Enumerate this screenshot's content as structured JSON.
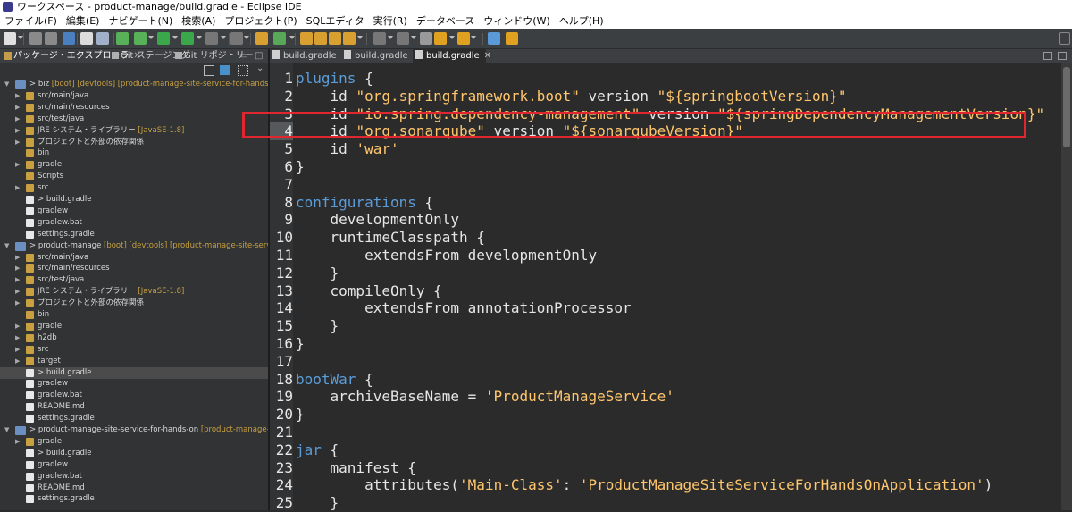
{
  "window": {
    "title": "ワークスペース - product-manage/build.gradle - Eclipse IDE"
  },
  "menu": [
    "ファイル(F)",
    "編集(E)",
    "ナビゲート(N)",
    "検索(A)",
    "プロジェクト(P)",
    "SQLエディタ",
    "実行(R)",
    "データベース",
    "ウィンドウ(W)",
    "ヘルプ(H)"
  ],
  "left_tabs": [
    "パッケージ・エクスプローラ",
    "Git ステージング",
    "Git リポジトリー"
  ],
  "tree": [
    {
      "tw": "▼",
      "lvl": 0,
      "kind": "project",
      "label": "> biz",
      "deco": " [boot] [devtools] [product-manage-site-service-for-hands-on mas"
    },
    {
      "tw": "▶",
      "lvl": 1,
      "kind": "src",
      "label": "src/main/java"
    },
    {
      "tw": "▶",
      "lvl": 1,
      "kind": "src",
      "label": "src/main/resources"
    },
    {
      "tw": "▶",
      "lvl": 1,
      "kind": "src",
      "label": "src/test/java"
    },
    {
      "tw": "▶",
      "lvl": 1,
      "kind": "lib",
      "label": "JRE システム・ライブラリー",
      "deco": " [JavaSE-1.8]"
    },
    {
      "tw": "▶",
      "lvl": 1,
      "kind": "lib",
      "label": "プロジェクトと外部の依存関係"
    },
    {
      "tw": "",
      "lvl": 1,
      "kind": "folder",
      "label": "bin"
    },
    {
      "tw": "▶",
      "lvl": 1,
      "kind": "folder",
      "label": "gradle"
    },
    {
      "tw": "",
      "lvl": 1,
      "kind": "folder",
      "label": "Scripts"
    },
    {
      "tw": "▶",
      "lvl": 1,
      "kind": "folder",
      "label": "src"
    },
    {
      "tw": "",
      "lvl": 1,
      "kind": "gradle",
      "label": "> build.gradle"
    },
    {
      "tw": "",
      "lvl": 1,
      "kind": "file",
      "label": "gradlew"
    },
    {
      "tw": "",
      "lvl": 1,
      "kind": "file",
      "label": "gradlew.bat"
    },
    {
      "tw": "",
      "lvl": 1,
      "kind": "gradle",
      "label": "settings.gradle"
    },
    {
      "tw": "▼",
      "lvl": 0,
      "kind": "project",
      "label": "> product-manage",
      "deco": " [boot] [devtools] [product-manage-site-service-for-"
    },
    {
      "tw": "▶",
      "lvl": 1,
      "kind": "src",
      "label": "src/main/java"
    },
    {
      "tw": "▶",
      "lvl": 1,
      "kind": "src",
      "label": "src/main/resources"
    },
    {
      "tw": "▶",
      "lvl": 1,
      "kind": "src",
      "label": "src/test/java"
    },
    {
      "tw": "▶",
      "lvl": 1,
      "kind": "lib",
      "label": "JRE システム・ライブラリー",
      "deco": " [JavaSE-1.8]"
    },
    {
      "tw": "▶",
      "lvl": 1,
      "kind": "lib",
      "label": "プロジェクトと外部の依存関係"
    },
    {
      "tw": "",
      "lvl": 1,
      "kind": "folder",
      "label": "bin"
    },
    {
      "tw": "▶",
      "lvl": 1,
      "kind": "folder",
      "label": "gradle"
    },
    {
      "tw": "▶",
      "lvl": 1,
      "kind": "folder",
      "label": "h2db"
    },
    {
      "tw": "▶",
      "lvl": 1,
      "kind": "folder",
      "label": "src"
    },
    {
      "tw": "▶",
      "lvl": 1,
      "kind": "folder",
      "label": "target"
    },
    {
      "tw": "",
      "lvl": 1,
      "kind": "gradle",
      "label": "> build.gradle",
      "selected": true
    },
    {
      "tw": "",
      "lvl": 1,
      "kind": "file",
      "label": "gradlew"
    },
    {
      "tw": "",
      "lvl": 1,
      "kind": "file",
      "label": "gradlew.bat"
    },
    {
      "tw": "",
      "lvl": 1,
      "kind": "file",
      "label": "README.md"
    },
    {
      "tw": "",
      "lvl": 1,
      "kind": "gradle",
      "label": "settings.gradle"
    },
    {
      "tw": "▼",
      "lvl": 0,
      "kind": "project",
      "label": "> product-manage-site-service-for-hands-on",
      "deco": " [product-manage-site-ser"
    },
    {
      "tw": "▶",
      "lvl": 1,
      "kind": "folder",
      "label": "gradle"
    },
    {
      "tw": "",
      "lvl": 1,
      "kind": "gradle",
      "label": "> build.gradle"
    },
    {
      "tw": "",
      "lvl": 1,
      "kind": "file",
      "label": "gradlew"
    },
    {
      "tw": "",
      "lvl": 1,
      "kind": "file",
      "label": "gradlew.bat"
    },
    {
      "tw": "",
      "lvl": 1,
      "kind": "file",
      "label": "README.md"
    },
    {
      "tw": "",
      "lvl": 1,
      "kind": "gradle",
      "label": "settings.gradle"
    }
  ],
  "editor_tabs": [
    {
      "label": "build.gradle",
      "active": false
    },
    {
      "label": "build.gradle",
      "active": false
    },
    {
      "label": "build.gradle",
      "active": true
    }
  ],
  "current_line": 4,
  "code_lines": [
    [
      {
        "t": "plugins",
        "c": "kw"
      },
      {
        "t": " {"
      }
    ],
    [
      {
        "t": "    id "
      },
      {
        "t": "\"org.springframework.boot\"",
        "c": "str"
      },
      {
        "t": " version "
      },
      {
        "t": "\"${springbootVersion}\"",
        "c": "str"
      }
    ],
    [
      {
        "t": "    id "
      },
      {
        "t": "\"io.spring.dependency-management\"",
        "c": "str"
      },
      {
        "t": " version "
      },
      {
        "t": "\"${springDependencyManagementVersion}\"",
        "c": "str"
      }
    ],
    [
      {
        "t": "    id "
      },
      {
        "t": "\"org.sonarqube\"",
        "c": "str"
      },
      {
        "t": " version "
      },
      {
        "t": "\"${sonarqubeVersion}\"",
        "c": "str"
      }
    ],
    [
      {
        "t": "    id "
      },
      {
        "t": "'war'",
        "c": "str"
      }
    ],
    [
      {
        "t": "}"
      }
    ],
    [
      {
        "t": ""
      }
    ],
    [
      {
        "t": "configurations",
        "c": "kw"
      },
      {
        "t": " {"
      }
    ],
    [
      {
        "t": "    developmentOnly"
      }
    ],
    [
      {
        "t": "    runtimeClasspath {"
      }
    ],
    [
      {
        "t": "        extendsFrom developmentOnly"
      }
    ],
    [
      {
        "t": "    }"
      }
    ],
    [
      {
        "t": "    compileOnly {"
      }
    ],
    [
      {
        "t": "        extendsFrom annotationProcessor"
      }
    ],
    [
      {
        "t": "    }"
      }
    ],
    [
      {
        "t": "}"
      }
    ],
    [
      {
        "t": ""
      }
    ],
    [
      {
        "t": "bootWar",
        "c": "kw"
      },
      {
        "t": " {"
      }
    ],
    [
      {
        "t": "    archiveBaseName = "
      },
      {
        "t": "'ProductManageService'",
        "c": "str"
      }
    ],
    [
      {
        "t": "}"
      }
    ],
    [
      {
        "t": ""
      }
    ],
    [
      {
        "t": "jar",
        "c": "kw"
      },
      {
        "t": " {"
      }
    ],
    [
      {
        "t": "    manifest {"
      }
    ],
    [
      {
        "t": "        attributes("
      },
      {
        "t": "'Main-Class'",
        "c": "str"
      },
      {
        "t": ": "
      },
      {
        "t": "'ProductManageSiteServiceForHandsOnApplication'",
        "c": "str"
      },
      {
        "t": ")"
      }
    ],
    [
      {
        "t": "    }"
      }
    ]
  ],
  "colors": {
    "keyword": "#5b9dd9",
    "string": "#ffc66d",
    "highlight_box": "#e0262e",
    "folder": "#c8a040"
  }
}
